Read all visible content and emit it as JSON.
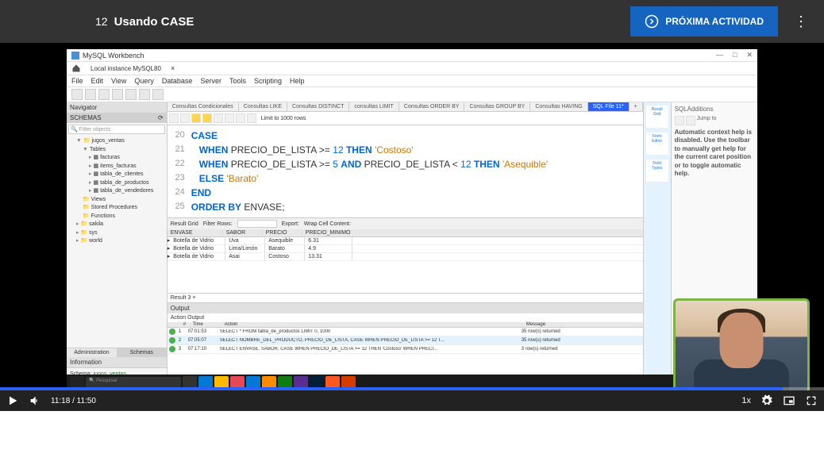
{
  "topbar": {
    "lesson_number": "12",
    "lesson_title": "Usando CASE",
    "next_button": "PRÓXIMA ACTIVIDAD"
  },
  "workbench": {
    "title": "MySQL Workbench",
    "instance": "Local instance MySQL80",
    "menu": [
      "File",
      "Edit",
      "View",
      "Query",
      "Database",
      "Server",
      "Tools",
      "Scripting",
      "Help"
    ],
    "navigator": {
      "header": "Navigator",
      "schemas_label": "SCHEMAS",
      "filter_placeholder": "Filter objects",
      "tree": {
        "db": "jugos_ventas",
        "tables_label": "Tables",
        "tables": [
          "facturas",
          "items_facturas",
          "tabla_de_clientes",
          "tabla_de_productos",
          "tabla_de_vendedores"
        ],
        "views": "Views",
        "stored": "Stored Procedures",
        "functions": "Functions",
        "other": [
          "sakila",
          "sys",
          "world"
        ]
      },
      "tabs": {
        "admin": "Administration",
        "schemas": "Schemas"
      },
      "info_label": "Information",
      "schema_prefix": "Schema:",
      "schema_name": "jugos_ventas"
    },
    "editor_tabs": [
      "Consultas Condicionales",
      "Consultas LIKE",
      "Consultas DISTINCT",
      "consultas LIMIT",
      "Consultas ORDER BY",
      "Consultas GROUP BY",
      "Consultas HAVING"
    ],
    "active_tab": "SQL File 11*",
    "limit_label": "Limit to 1000 rows",
    "code": [
      {
        "n": "20",
        "tokens": [
          {
            "t": "CASE",
            "c": "kw"
          }
        ]
      },
      {
        "n": "21",
        "tokens": [
          {
            "t": "   ",
            "c": ""
          },
          {
            "t": "WHEN",
            "c": "kw"
          },
          {
            "t": " PRECIO_DE_LISTA ",
            "c": ""
          },
          {
            "t": ">=",
            "c": "op"
          },
          {
            "t": " ",
            "c": ""
          },
          {
            "t": "12",
            "c": "num"
          },
          {
            "t": " ",
            "c": ""
          },
          {
            "t": "THEN",
            "c": "kw"
          },
          {
            "t": " ",
            "c": ""
          },
          {
            "t": "'Costoso'",
            "c": "str"
          }
        ]
      },
      {
        "n": "22",
        "tokens": [
          {
            "t": "   ",
            "c": ""
          },
          {
            "t": "WHEN",
            "c": "kw"
          },
          {
            "t": " PRECIO_DE_LISTA ",
            "c": ""
          },
          {
            "t": ">=",
            "c": "op"
          },
          {
            "t": " ",
            "c": ""
          },
          {
            "t": "5",
            "c": "num"
          },
          {
            "t": " ",
            "c": ""
          },
          {
            "t": "AND",
            "c": "kw"
          },
          {
            "t": " PRECIO_DE_LISTA ",
            "c": ""
          },
          {
            "t": "<",
            "c": "op"
          },
          {
            "t": " ",
            "c": ""
          },
          {
            "t": "12",
            "c": "num"
          },
          {
            "t": " ",
            "c": ""
          },
          {
            "t": "THEN",
            "c": "kw"
          },
          {
            "t": " ",
            "c": ""
          },
          {
            "t": "'Asequible'",
            "c": "str"
          }
        ]
      },
      {
        "n": "23",
        "tokens": [
          {
            "t": "   ",
            "c": ""
          },
          {
            "t": "ELSE",
            "c": "kw"
          },
          {
            "t": " ",
            "c": ""
          },
          {
            "t": "'Barato'",
            "c": "str"
          }
        ]
      },
      {
        "n": "24",
        "tokens": [
          {
            "t": "END",
            "c": "kw"
          }
        ]
      },
      {
        "n": "25",
        "tokens": [
          {
            "t": "ORDER BY",
            "c": "kw"
          },
          {
            "t": " ENVASE;",
            "c": ""
          }
        ]
      }
    ],
    "result": {
      "toolbar": {
        "grid": "Result Grid",
        "filter": "Filter Rows:",
        "export": "Export:",
        "wrap": "Wrap Cell Content:"
      },
      "headers": [
        "ENVASE",
        "SABOR",
        "PRECIO",
        "PRECIO_MINIMO"
      ],
      "rows": [
        [
          "Botella de Vidrio",
          "Uva",
          "Asequible",
          "6.31"
        ],
        [
          "Botella de Vidrio",
          "Lima/Limón",
          "Barato",
          "4.9"
        ],
        [
          "Botella de Vidrio",
          "Asai",
          "Costoso",
          "13.31"
        ]
      ],
      "tab_label": "Result 3"
    },
    "output": {
      "header": "Output",
      "type": "Action Output",
      "columns": [
        "",
        "Time",
        "Action",
        "Message"
      ],
      "rows": [
        [
          "1",
          "07:01:53",
          "SELECT * FROM tabla_de_productos LIMIT 0, 1000",
          "35 row(s) returned"
        ],
        [
          "2",
          "07:05:07",
          "SELECT NOMBRE_DEL_PRODUCTO, PRECIO_DE_LISTA, CASE  WHEN PRECIO_DE_LISTA >= 12 T...",
          "35 row(s) returned"
        ],
        [
          "3",
          "07:17:10",
          "SELECT ENVASE, SABOR, CASE  WHEN PRECIO_DE_LISTA >= 12 THEN 'Costoso'  WHEN PRECI...",
          "3 row(s) returned"
        ]
      ]
    },
    "sqladd": {
      "title": "SQLAdditions",
      "jump": "Jump to",
      "help": "Automatic context help is disabled. Use the toolbar to manually get help for the current caret position or to toggle automatic help."
    },
    "side_items": [
      "Result Grid",
      "Form Editor",
      "Field Types"
    ]
  },
  "player": {
    "current": "11:18",
    "total": "11:50",
    "speed": "1x"
  },
  "taskbar": {
    "search": "Pesquisar"
  }
}
